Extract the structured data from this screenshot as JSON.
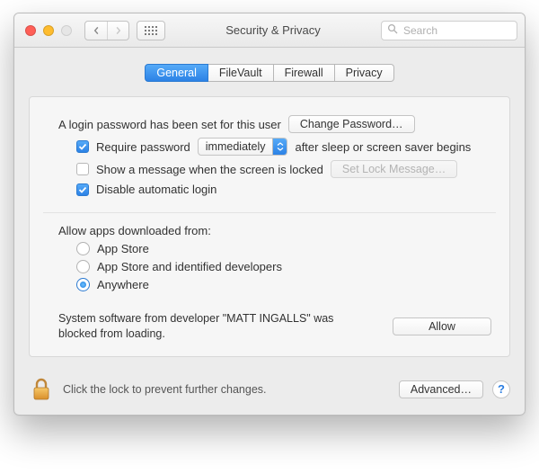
{
  "titlebar": {
    "title": "Security & Privacy",
    "search_placeholder": "Search"
  },
  "tabs": {
    "general": "General",
    "filevault": "FileVault",
    "firewall": "Firewall",
    "privacy": "Privacy"
  },
  "login": {
    "password_set": "A login password has been set for this user",
    "change_password": "Change Password…",
    "require_password_label": "Require password",
    "require_delay": "immediately",
    "require_after": "after sleep or screen saver begins",
    "show_message": "Show a message when the screen is locked",
    "set_lock_message": "Set Lock Message…",
    "disable_autologin": "Disable automatic login"
  },
  "download": {
    "heading": "Allow apps downloaded from:",
    "opt_appstore": "App Store",
    "opt_identified": "App Store and identified developers",
    "opt_anywhere": "Anywhere"
  },
  "blocked": {
    "message": "System software from developer \"MATT INGALLS\" was blocked from loading.",
    "allow": "Allow"
  },
  "footer": {
    "lock_text": "Click the lock to prevent further changes.",
    "advanced": "Advanced…",
    "help": "?"
  }
}
